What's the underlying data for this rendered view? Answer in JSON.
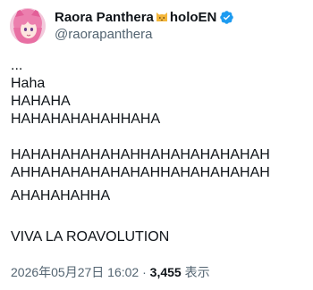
{
  "tweet": {
    "author": {
      "name": "Raora Panthera",
      "name_suffix": "holoEN",
      "handle": "@raorapanthera",
      "verified_color": "#1d9bf0"
    },
    "body_lines": {
      "l1": "...",
      "l2": "Haha",
      "l3": "HAHAHA",
      "l4": "HAHAHAHAHAHHAHA",
      "l5": "HAHAHAHAHAHAHHAHAHAHAHAHAH",
      "l6": "AHHAHAHAHAHAHAHHAHAHAHAHAH",
      "l7": "AHAHAHAHHA",
      "l8": "VIVA LA ROAVOLUTION"
    },
    "meta": {
      "timestamp": "2026年05月27日 16:02",
      "separator": " · ",
      "views_count": "3,455",
      "views_label": " 表示"
    }
  }
}
